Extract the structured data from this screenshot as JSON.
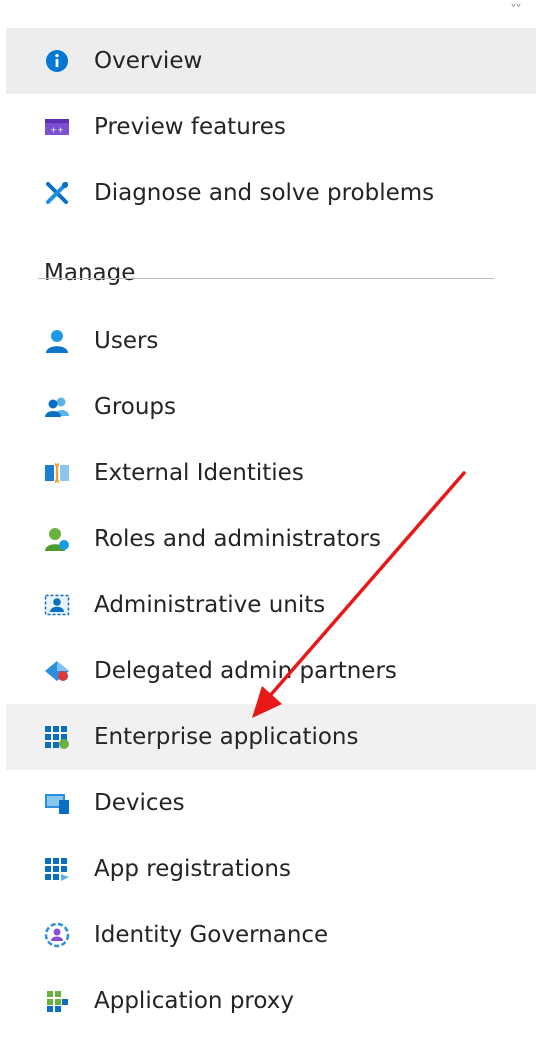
{
  "collapse_icon": "double-chevron-icon",
  "collapse_glyph": "˅˅",
  "top_items": [
    {
      "label": "Overview",
      "icon": "info-icon",
      "active": true
    },
    {
      "label": "Preview features",
      "icon": "preview-icon"
    },
    {
      "label": "Diagnose and solve problems",
      "icon": "wrench-icon"
    }
  ],
  "manage": {
    "title": "Manage",
    "items": [
      {
        "label": "Users",
        "icon": "user-icon"
      },
      {
        "label": "Groups",
        "icon": "groups-icon"
      },
      {
        "label": "External Identities",
        "icon": "external-identities-icon"
      },
      {
        "label": "Roles and administrators",
        "icon": "roles-icon"
      },
      {
        "label": "Administrative units",
        "icon": "admin-units-icon"
      },
      {
        "label": "Delegated admin partners",
        "icon": "delegated-admin-icon"
      },
      {
        "label": "Enterprise applications",
        "icon": "enterprise-apps-icon",
        "highlighted": true
      },
      {
        "label": "Devices",
        "icon": "devices-icon"
      },
      {
        "label": "App registrations",
        "icon": "app-registrations-icon"
      },
      {
        "label": "Identity Governance",
        "icon": "identity-governance-icon"
      },
      {
        "label": "Application proxy",
        "icon": "application-proxy-icon"
      }
    ]
  },
  "colors": {
    "accent_blue": "#0078d4",
    "active_bg": "#ededed",
    "annotation_arrow": "#e81818"
  }
}
